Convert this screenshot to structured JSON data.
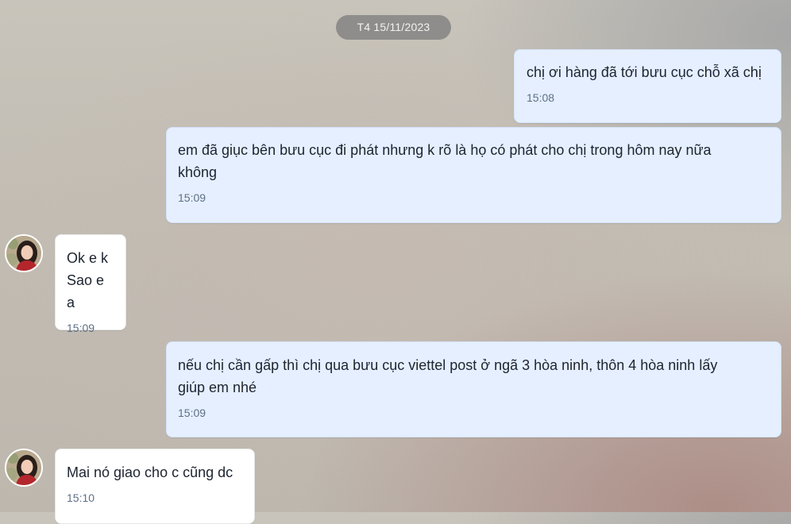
{
  "date_separator": "T4 15/11/2023",
  "messages": [
    {
      "direction": "outgoing",
      "text": "chị ơi hàng đã tới bưu cục chỗ xã chị",
      "time": "15:08"
    },
    {
      "direction": "outgoing",
      "text": "em đã giục bên bưu cục đi phát nhưng k rõ là họ có phát cho chị trong hôm nay nữa\nkhông",
      "time": "15:09"
    },
    {
      "direction": "incoming",
      "text": "Ok e k\nSao e a",
      "time": "15:09",
      "avatar": "contact-avatar"
    },
    {
      "direction": "outgoing",
      "text": "nếu chị cần gấp thì chị qua bưu cục viettel post ở ngã 3 hòa ninh, thôn 4 hòa ninh lấy\ngiúp em nhé",
      "time": "15:09"
    },
    {
      "direction": "incoming",
      "text": "Mai nó giao cho c cũng dc",
      "time": "15:10",
      "avatar": "contact-avatar"
    }
  ],
  "colors": {
    "outgoing_bubble": "#e5efff",
    "incoming_bubble": "#ffffff",
    "timestamp": "#5f6f85",
    "date_pill": "#7a7a7a"
  }
}
